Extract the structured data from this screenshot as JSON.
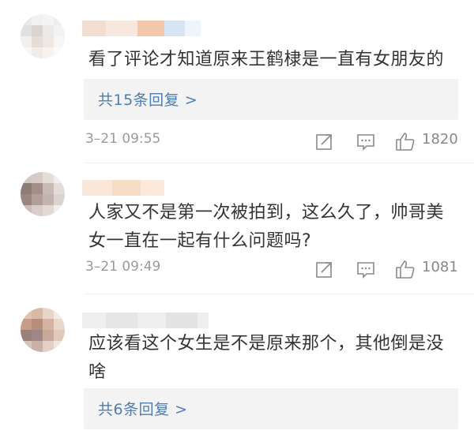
{
  "comments": [
    {
      "text": "看了评论才知道原来王鹤棣是一直有女朋友的",
      "reply_link": "共15条回复 >",
      "time": "3–21 09:55",
      "likes": "1820",
      "actions": [
        "forward-icon",
        "comment-icon",
        "like-icon"
      ]
    },
    {
      "text_line1": "人家又不是第一次被拍到，这么久了，帅哥美",
      "text_line2": "女一直在一起有什么问题吗?",
      "time": "3–21 09:49",
      "likes": "1081",
      "actions": [
        "forward-icon",
        "comment-icon",
        "like-icon"
      ]
    },
    {
      "text_line1": "应该看这个女生是不是原来那个，其他倒是没",
      "text_line2": "啥",
      "reply_link": "共6条回复 >"
    }
  ],
  "colors": {
    "link": "#507daf",
    "meta": "#9a9a9a",
    "reply_bg": "#f3f3f3"
  }
}
